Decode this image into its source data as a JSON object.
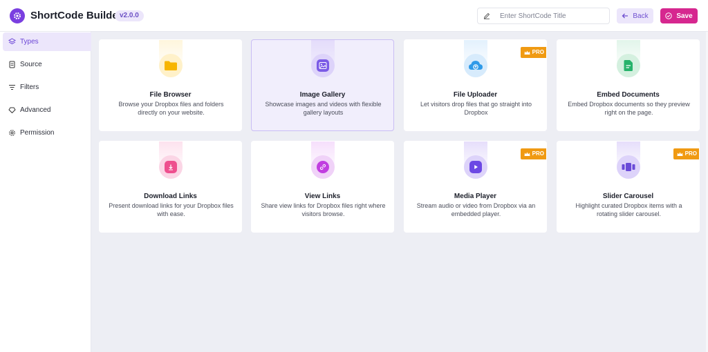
{
  "header": {
    "app_title": "ShortCode Builder",
    "version": "v2.0.0",
    "title_input": {
      "placeholder": "Enter ShortCode Title",
      "value": ""
    },
    "back_label": "Back",
    "save_label": "Save"
  },
  "sidebar": {
    "items": [
      {
        "label": "Types",
        "icon": "types-icon",
        "active": true
      },
      {
        "label": "Source",
        "icon": "source-icon",
        "active": false
      },
      {
        "label": "Filters",
        "icon": "filters-icon",
        "active": false
      },
      {
        "label": "Advanced",
        "icon": "advanced-icon",
        "active": false
      },
      {
        "label": "Permission",
        "icon": "permission-icon",
        "active": false
      }
    ]
  },
  "cards": [
    {
      "title": "File Browser",
      "desc": "Browse your Dropbox files and folders directly on your website.",
      "icon": "folder-icon",
      "color": "#f7b500",
      "pro": false,
      "selected": false
    },
    {
      "title": "Image Gallery",
      "desc": "Showcase images and videos with flexible gallery layouts",
      "icon": "image-icon",
      "color": "#7b5be6",
      "pro": false,
      "selected": true
    },
    {
      "title": "File Uploader",
      "desc": "Let visitors drop files that go straight into Dropbox",
      "icon": "upload-cloud-icon",
      "color": "#2f9ae8",
      "pro": true,
      "selected": false
    },
    {
      "title": "Embed Documents",
      "desc": "Embed Dropbox documents so they preview right on the page.",
      "icon": "document-icon",
      "color": "#27b36b",
      "pro": false,
      "selected": false
    },
    {
      "title": "Download Links",
      "desc": "Present download links for your Dropbox files with ease.",
      "icon": "download-icon",
      "color": "#ee4f8e",
      "pro": false,
      "selected": false
    },
    {
      "title": "View Links",
      "desc": "Share view links for Dropbox files right where visitors browse.",
      "icon": "link-icon",
      "color": "#c13ee0",
      "pro": false,
      "selected": false
    },
    {
      "title": "Media Player",
      "desc": "Stream audio or video from Dropbox via an embedded player.",
      "icon": "play-icon",
      "color": "#6c48e4",
      "pro": true,
      "selected": false
    },
    {
      "title": "Slider Carousel",
      "desc": "Highlight curated Dropbox items with a rotating slider carousel.",
      "icon": "carousel-icon",
      "color": "#6a4bd8",
      "pro": true,
      "selected": false
    }
  ],
  "pro_label": "PRO",
  "colors": {
    "accent": "#7a3fe0",
    "save": "#d6278f",
    "pro": "#f09a12"
  }
}
